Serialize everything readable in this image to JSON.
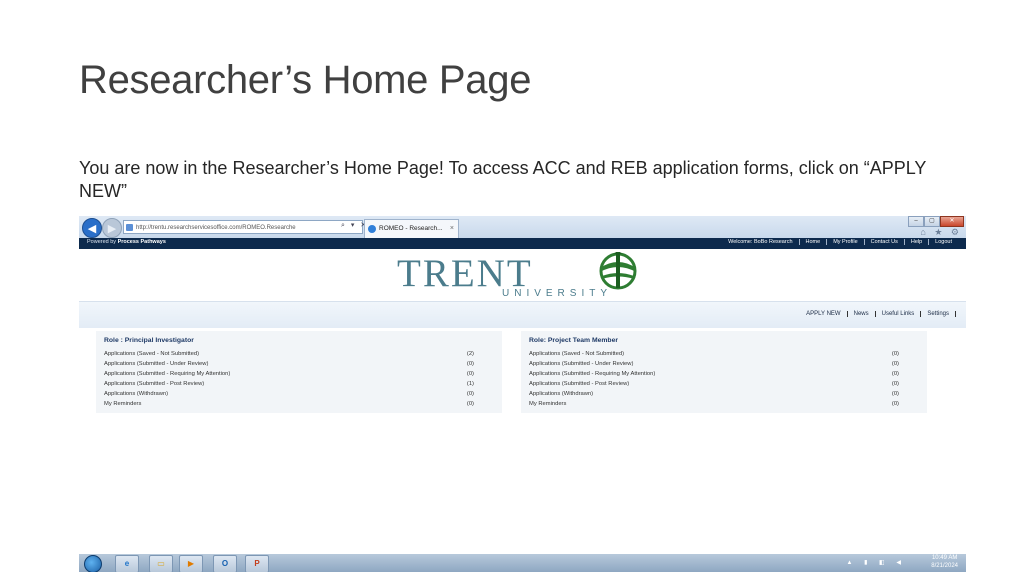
{
  "slide": {
    "title": "Researcher’s Home Page",
    "body": "You are now in the Researcher’s Home Page! To access ACC and REB application forms, click on “APPLY NEW”"
  },
  "browser": {
    "address": "http://trentu.researchservicesoffice.com/ROMEO.Researche",
    "tab_title": "ROMEO - Research...",
    "tab_close": "×",
    "win_min": "–",
    "win_max": "▢",
    "win_close": "✕",
    "back_glyph": "◀",
    "forward_glyph": "▶",
    "addr_tools": "⌕ ▾ ✕",
    "fav_icons": "⌂ ★ ⚙"
  },
  "site": {
    "powered_prefix": "Powered by ",
    "powered_brand": "Process Pathways",
    "top_links": [
      "Welcome: BoBo Research",
      "Home",
      "My Profile",
      "Contact Us",
      "Help",
      "Logout"
    ],
    "logo_word": "TRENT",
    "logo_sub": "UNIVERSITY",
    "actions": [
      "APPLY NEW",
      "News",
      "Useful Links",
      "Settings"
    ]
  },
  "roles": [
    {
      "title": "Role : Principal Investigator",
      "rows": [
        {
          "label": "Applications (Saved - Not Submitted)",
          "count": "(2)"
        },
        {
          "label": "Applications (Submitted - Under Review)",
          "count": "(0)"
        },
        {
          "label": "Applications (Submitted - Requiring My Attention)",
          "count": "(0)"
        },
        {
          "label": "Applications (Submitted - Post Review)",
          "count": "(1)"
        },
        {
          "label": "Applications (Withdrawn)",
          "count": "(0)"
        },
        {
          "label": "My Reminders",
          "count": "(0)"
        }
      ]
    },
    {
      "title": "Role: Project Team Member",
      "rows": [
        {
          "label": "Applications (Saved - Not Submitted)",
          "count": "(0)"
        },
        {
          "label": "Applications (Submitted - Under Review)",
          "count": "(0)"
        },
        {
          "label": "Applications (Submitted - Requiring My Attention)",
          "count": "(0)"
        },
        {
          "label": "Applications (Submitted - Post Review)",
          "count": "(0)"
        },
        {
          "label": "Applications (Withdrawn)",
          "count": "(0)"
        },
        {
          "label": "My Reminders",
          "count": "(0)"
        }
      ]
    }
  ],
  "taskbar": {
    "apps": [
      "ie-icon",
      "folder-icon",
      "media-player-icon",
      "outlook-icon",
      "powerpoint-icon"
    ],
    "app_glyphs": [
      "e",
      "▭",
      "▶",
      "O",
      "P"
    ],
    "tray_icons": "▲ ▮ ◧ ◀",
    "time": "10:49 AM",
    "date": "8/21/2024"
  },
  "colors": {
    "site_navy": "#0d2a4d",
    "trent_teal": "#4b7c8c",
    "trent_green": "#2e7d32",
    "role_title": "#1f3a66"
  }
}
